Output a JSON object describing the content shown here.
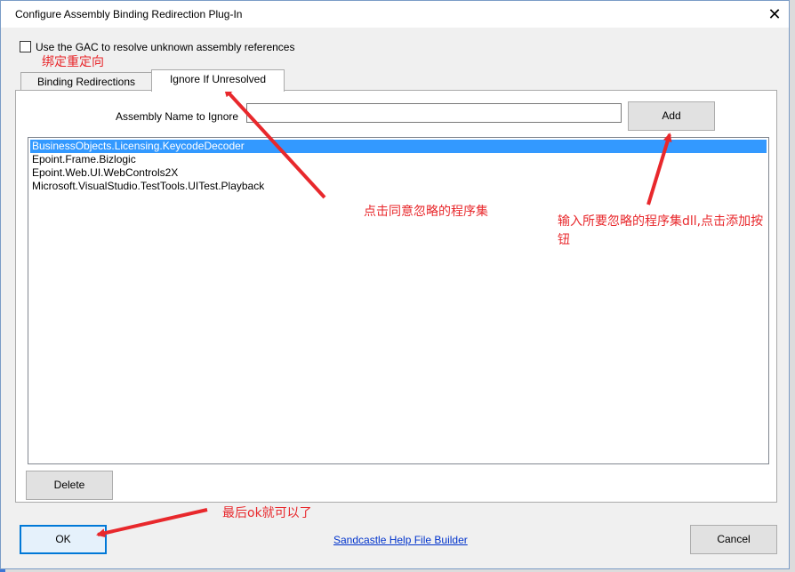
{
  "window": {
    "title": "Configure Assembly Binding Redirection Plug-In"
  },
  "options": {
    "use_gac_label": "Use the GAC to resolve unknown assembly references",
    "use_gac_checked": false
  },
  "tabs": [
    {
      "label": "Binding Redirections",
      "active": false
    },
    {
      "label": "Ignore If Unresolved",
      "active": true
    }
  ],
  "ignore_tab": {
    "assembly_name_label": "Assembly Name to Ignore",
    "assembly_name_value": "",
    "add_button": "Add",
    "items": [
      {
        "label": "BusinessObjects.Licensing.KeycodeDecoder",
        "selected": true
      },
      {
        "label": "Epoint.Frame.Bizlogic",
        "selected": false
      },
      {
        "label": "Epoint.Web.UI.WebControls2X",
        "selected": false
      },
      {
        "label": "Microsoft.VisualStudio.TestTools.UITest.Playback",
        "selected": false
      }
    ]
  },
  "buttons": {
    "delete": "Delete",
    "ok": "OK",
    "cancel": "Cancel",
    "help_link": "Sandcastle Help File Builder"
  },
  "annotations": {
    "binding_redirect": "绑定重定向",
    "click_ignore": "点击同意忽略的程序集",
    "input_add_line1": "输入所要忽略的程序集dll,点击添加按",
    "input_add_line2": "钮",
    "finally_ok": "最后ok就可以了"
  },
  "colors": {
    "selection": "#3399ff",
    "annotation": "#e8282c",
    "link": "#0033cc"
  }
}
